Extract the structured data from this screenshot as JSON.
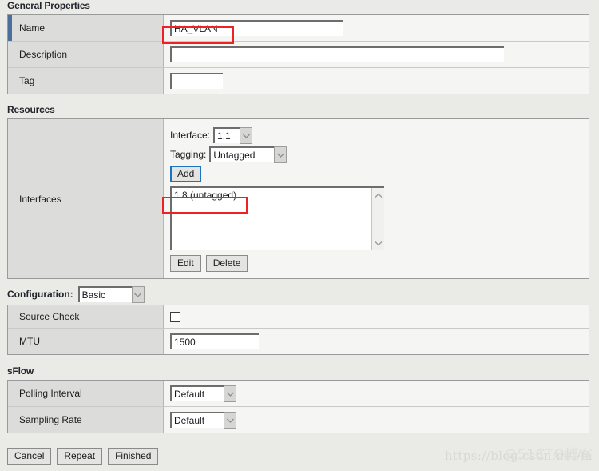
{
  "sections": {
    "general": {
      "title": "General Properties",
      "rows": [
        {
          "label": "Name",
          "value": "HA_VLAN",
          "placeholder": ""
        },
        {
          "label": "Description",
          "value": "",
          "placeholder": ""
        },
        {
          "label": "Tag",
          "value": "",
          "placeholder": ""
        }
      ]
    },
    "resources": {
      "title": "Resources",
      "label": "Interfaces",
      "interface_label": "Interface:",
      "interface_value": "1.1",
      "tagging_label": "Tagging:",
      "tagging_value": "Untagged",
      "add_label": "Add",
      "list_items": [
        "1.8 (untagged)"
      ],
      "edit_label": "Edit",
      "delete_label": "Delete"
    },
    "configuration": {
      "label": "Configuration:",
      "value": "Basic",
      "rows": [
        {
          "label": "Source Check",
          "type": "checkbox",
          "checked": false
        },
        {
          "label": "MTU",
          "type": "text",
          "value": "1500"
        }
      ]
    },
    "sflow": {
      "title": "sFlow",
      "rows": [
        {
          "label": "Polling Interval",
          "value": "Default"
        },
        {
          "label": "Sampling Rate",
          "value": "Default"
        }
      ]
    }
  },
  "footer": {
    "cancel_label": "Cancel",
    "repeat_label": "Repeat",
    "finished_label": "Finished"
  },
  "watermark": {
    "url": "https://blog.csdn.net/m",
    "overlay": "@51CTO博客"
  },
  "colors": {
    "accent_required": "#4a6f9b",
    "focus_blue": "#1e73be",
    "annotation_red": "#ee2222",
    "page_background": "#eaeae6",
    "panel_background": "#f5f5f3",
    "label_background": "#dcdcda"
  }
}
